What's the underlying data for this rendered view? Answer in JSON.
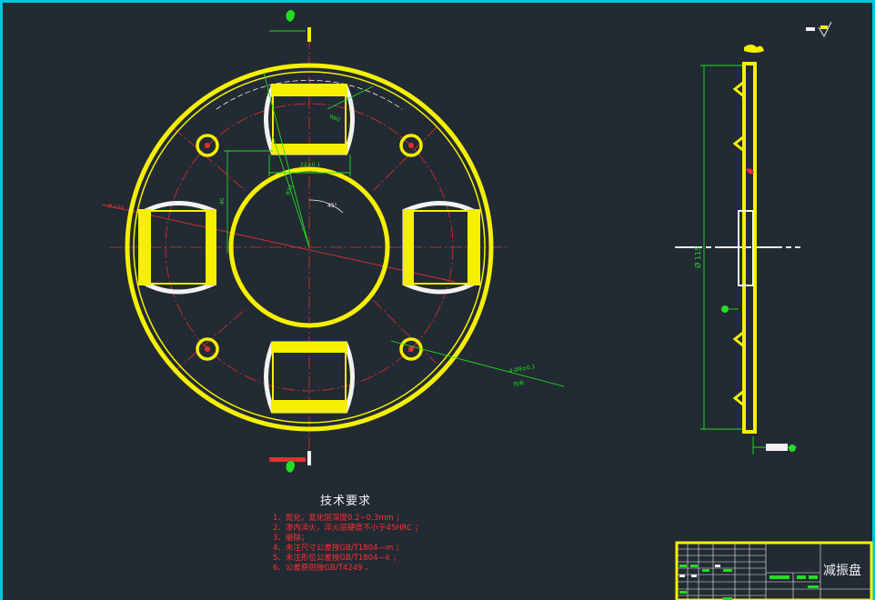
{
  "drawing": {
    "part_name": "减振盘",
    "colors": {
      "background": "#222a33",
      "outline": "#f5f000",
      "centerline": "#e03030",
      "dimension": "#22dd22",
      "border": "#00c8d8",
      "white": "#f2f2f2"
    }
  },
  "front_view": {
    "dim_outer_diameter": "Ø 130",
    "dim_hole_diameter": "4-Ø8±0.1",
    "dim_hole_note": "均布",
    "dim_slot_width": "22±0.1",
    "dim_slot_height": "40",
    "dim_radius": "R32",
    "dim_angle": "45°",
    "dim_angle_small": "R60"
  },
  "side_view": {
    "dim_diameter": "Ø 115"
  },
  "technical_requirements": {
    "title": "技术要求",
    "items": [
      "1、氮化，氮化层深度0.2~0.3mm ；",
      "2、渗内淬火，淬火层硬度不小于45HRC ；",
      "3、磨除；",
      "4、未注尺寸公差按GB/T1804—m ；",
      "5、未注形位公差按GB/T1804—k ；",
      "6、公差原则按GB/T4249 。"
    ]
  }
}
